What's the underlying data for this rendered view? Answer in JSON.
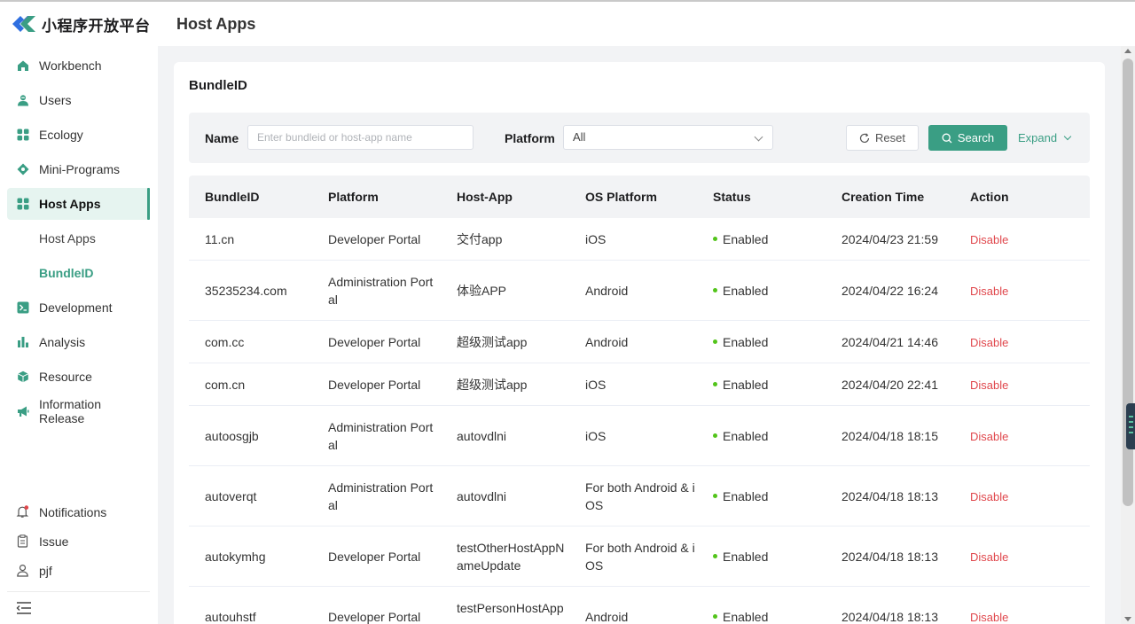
{
  "brand": {
    "name": "小程序开放平台"
  },
  "header": {
    "title": "Host Apps"
  },
  "sidebar": {
    "items": [
      {
        "label": "Workbench",
        "icon": "home-icon"
      },
      {
        "label": "Users",
        "icon": "user-icon"
      },
      {
        "label": "Ecology",
        "icon": "grid-icon"
      },
      {
        "label": "Mini-Programs",
        "icon": "diamond-icon"
      },
      {
        "label": "Host Apps",
        "icon": "grid-icon",
        "active": true
      },
      {
        "label": "Host Apps",
        "sub": true
      },
      {
        "label": "BundleID",
        "sub": true,
        "active": true
      },
      {
        "label": "Development",
        "icon": "terminal-icon"
      },
      {
        "label": "Analysis",
        "icon": "bar-chart-icon"
      },
      {
        "label": "Resource",
        "icon": "cube-icon"
      },
      {
        "label": "Information Release",
        "icon": "megaphone-icon"
      }
    ],
    "bottom": [
      {
        "label": "Notifications",
        "icon": "bell-icon"
      },
      {
        "label": "Issue",
        "icon": "clipboard-icon"
      },
      {
        "label": "pjf",
        "icon": "user-outline-icon"
      }
    ]
  },
  "card": {
    "title": "BundleID"
  },
  "filter": {
    "name_label": "Name",
    "name_placeholder": "Enter bundleid or host-app name",
    "platform_label": "Platform",
    "platform_value": "All",
    "reset_label": "Reset",
    "search_label": "Search",
    "expand_label": "Expand"
  },
  "table": {
    "columns": [
      "BundleID",
      "Platform",
      "Host-App",
      "OS Platform",
      "Status",
      "Creation Time",
      "Action"
    ],
    "rows": [
      {
        "bundle": "11.cn",
        "platform": "Developer Portal",
        "host": "交付app",
        "os": "iOS",
        "status": "Enabled",
        "time": "2024/04/23 21:59",
        "action": "Disable"
      },
      {
        "bundle": "35235234.com",
        "platform": "Administration Portal",
        "host": "体验APP",
        "os": "Android",
        "status": "Enabled",
        "time": "2024/04/22 16:24",
        "action": "Disable"
      },
      {
        "bundle": "com.cc",
        "platform": "Developer Portal",
        "host": "超级测试app",
        "os": "Android",
        "status": "Enabled",
        "time": "2024/04/21 14:46",
        "action": "Disable"
      },
      {
        "bundle": "com.cn",
        "platform": "Developer Portal",
        "host": "超级测试app",
        "os": "iOS",
        "status": "Enabled",
        "time": "2024/04/20 22:41",
        "action": "Disable"
      },
      {
        "bundle": "autoosgjb",
        "platform": "Administration Portal",
        "host": "autovdlni",
        "os": "iOS",
        "status": "Enabled",
        "time": "2024/04/18 18:15",
        "action": "Disable"
      },
      {
        "bundle": "autoverqt",
        "platform": "Administration Portal",
        "host": "autovdlni",
        "os": "For both Android & iOS",
        "status": "Enabled",
        "time": "2024/04/18 18:13",
        "action": "Disable"
      },
      {
        "bundle": "autokymhg",
        "platform": "Developer Portal",
        "host": "testOtherHostAppNameUpdate",
        "os": "For both Android & iOS",
        "status": "Enabled",
        "time": "2024/04/18 18:13",
        "action": "Disable"
      },
      {
        "bundle": "autouhstf",
        "platform": "Developer Portal",
        "host": "testPersonHostApp",
        "os": "Android",
        "status": "Enabled",
        "time": "2024/04/18 18:13",
        "action": "Disable"
      }
    ]
  },
  "colors": {
    "accent": "#3a9e84",
    "danger": "#e0474c",
    "status_ok": "#52c41a"
  }
}
